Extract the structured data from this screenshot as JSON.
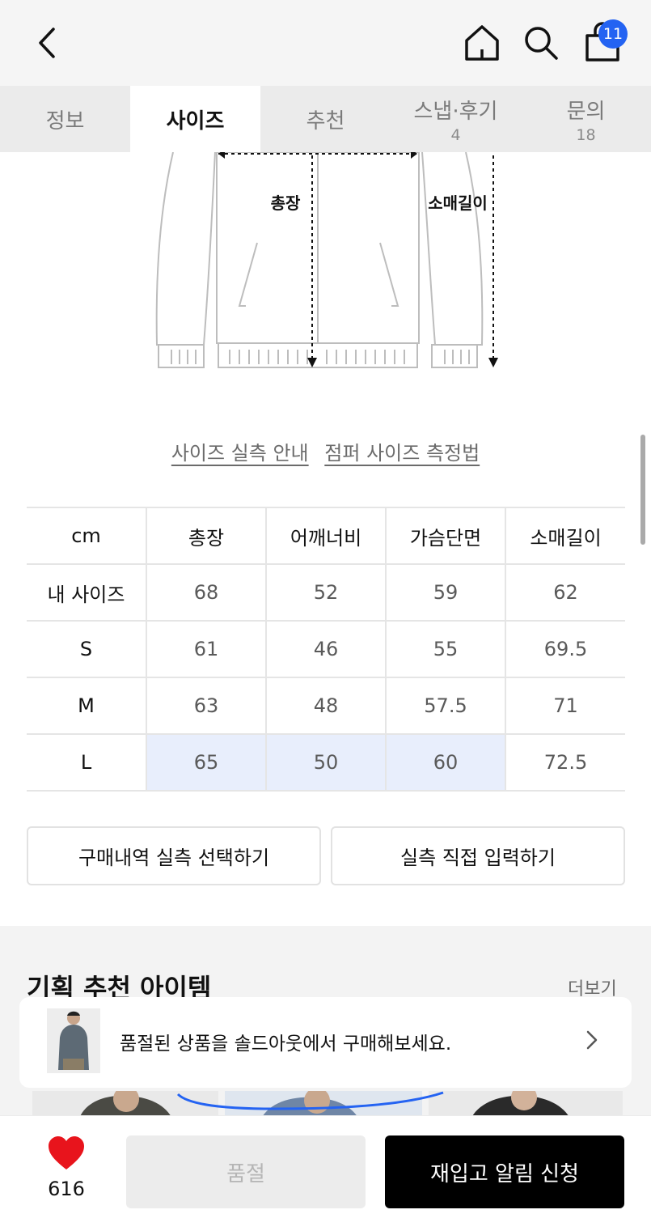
{
  "header": {
    "cart_count": "11",
    "icons": [
      "back-arrow-icon",
      "home-icon",
      "search-icon",
      "shopping-bag-icon"
    ]
  },
  "tabs": [
    {
      "label": "정보",
      "count": ""
    },
    {
      "label": "사이즈",
      "count": ""
    },
    {
      "label": "추천",
      "count": ""
    },
    {
      "label": "스냅·후기",
      "count": "4"
    },
    {
      "label": "문의",
      "count": "18"
    }
  ],
  "diagram": {
    "label_length": "총장",
    "label_sleeve": "소매길이"
  },
  "links": {
    "guide": "사이즈 실측 안내",
    "method": "점퍼 사이즈 측정법"
  },
  "size_table": {
    "headers": [
      "cm",
      "총장",
      "어깨너비",
      "가슴단면",
      "소매길이"
    ],
    "rows": [
      [
        "내 사이즈",
        "68",
        "52",
        "59",
        "62"
      ],
      [
        "S",
        "61",
        "46",
        "55",
        "69.5"
      ],
      [
        "M",
        "63",
        "48",
        "57.5",
        "71"
      ],
      [
        "L",
        "65",
        "50",
        "60",
        "72.5"
      ]
    ]
  },
  "actions": {
    "purchase_history": "구매내역 실측 선택하기",
    "manual_input": "실측 직접 입력하기"
  },
  "recommend": {
    "title": "기획 추천 아이템",
    "more": "더보기"
  },
  "toast": {
    "message": "품절된 상품을 솔드아웃에서 구매해보세요."
  },
  "bottom": {
    "likes": "616",
    "soldout_label": "품절",
    "notify_label": "재입고 알림 신청"
  },
  "colors": {
    "accent": "#2463f2",
    "highlight": "#e8eefc",
    "like": "#e8141c"
  }
}
